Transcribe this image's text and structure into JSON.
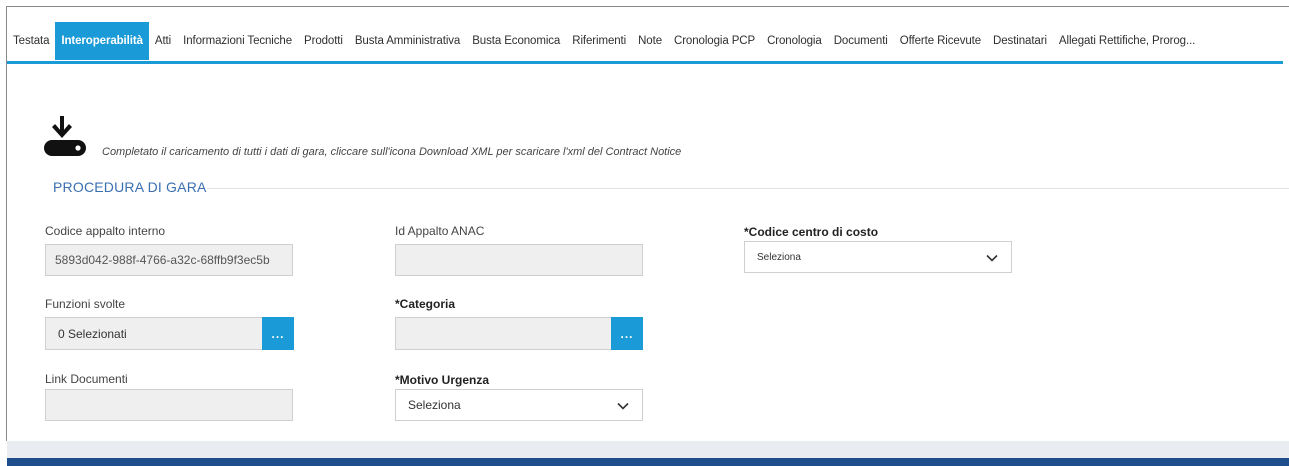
{
  "tabs": [
    {
      "label": "Testata",
      "active": false
    },
    {
      "label": "Interoperabilità",
      "active": true
    },
    {
      "label": "Atti",
      "active": false
    },
    {
      "label": "Informazioni Tecniche",
      "active": false
    },
    {
      "label": "Prodotti",
      "active": false
    },
    {
      "label": "Busta Amministrativa",
      "active": false
    },
    {
      "label": "Busta Economica",
      "active": false
    },
    {
      "label": "Riferimenti",
      "active": false
    },
    {
      "label": "Note",
      "active": false
    },
    {
      "label": "Cronologia PCP",
      "active": false
    },
    {
      "label": "Cronologia",
      "active": false
    },
    {
      "label": "Documenti",
      "active": false
    },
    {
      "label": "Offerte Ricevute",
      "active": false
    },
    {
      "label": "Destinatari",
      "active": false
    },
    {
      "label": "Allegati Rettifiche, Proroghe",
      "display": "Allegati Rettifiche, Prorog...",
      "active": false
    }
  ],
  "download": {
    "icon": "download-icon",
    "message": "Completato il caricamento di tutti i dati di gara, cliccare sull'icona Download XML per scaricare l'xml del Contract Notice"
  },
  "section": {
    "title": "PROCEDURA DI GARA"
  },
  "form": {
    "codice_appalto": {
      "label": "Codice appalto interno",
      "value": "5893d042-988f-4766-a32c-68ffb9f3ec5b"
    },
    "id_appalto_anac": {
      "label": "Id Appalto ANAC",
      "value": ""
    },
    "codice_centro_costo": {
      "label": "*Codice centro di costo",
      "value": "Seleziona"
    },
    "funzioni_svolte": {
      "label": "Funzioni svolte",
      "value": "0 Selezionati",
      "button": "..."
    },
    "categoria": {
      "label": "*Categoria",
      "value": "",
      "button": "..."
    },
    "link_documenti": {
      "label": "Link Documenti",
      "value": ""
    },
    "motivo_urgenza": {
      "label": "*Motivo Urgenza",
      "value": "Seleziona"
    }
  },
  "colors": {
    "accent": "#1a9ad6",
    "section_title": "#3a6fb0",
    "footer": "#1f4e8c"
  }
}
